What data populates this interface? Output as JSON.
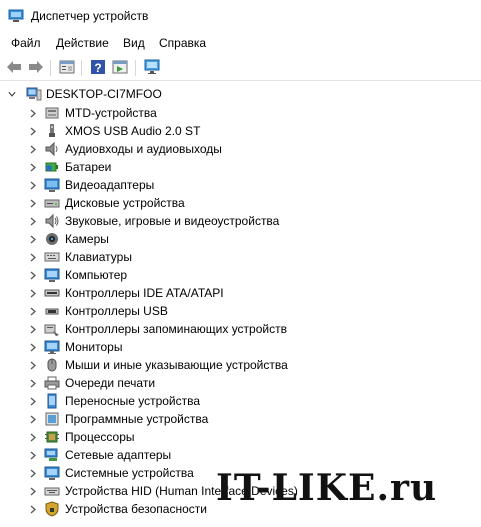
{
  "window": {
    "title": "Диспетчер устройств"
  },
  "menu": [
    {
      "label": "Файл"
    },
    {
      "label": "Действие"
    },
    {
      "label": "Вид"
    },
    {
      "label": "Справка"
    }
  ],
  "toolbar": {
    "buttons": [
      "back-arrow-icon",
      "forward-arrow-icon",
      "properties-icon",
      "help-icon",
      "run-icon",
      "monitor-scan-icon"
    ]
  },
  "tree": {
    "root": {
      "label": "DESKTOP-CI7MFOO",
      "icon": "computer-icon"
    },
    "items": [
      {
        "label": "MTD-устройства",
        "icon": "mtd-icon"
      },
      {
        "label": "XMOS USB Audio 2.0 ST",
        "icon": "usb-audio-icon"
      },
      {
        "label": "Аудиовходы и аудиовыходы",
        "icon": "speaker-icon"
      },
      {
        "label": "Батареи",
        "icon": "battery-icon"
      },
      {
        "label": "Видеоадаптеры",
        "icon": "display-adapter-icon"
      },
      {
        "label": "Дисковые устройства",
        "icon": "disk-drive-icon"
      },
      {
        "label": "Звуковые, игровые и видеоустройства",
        "icon": "sound-icon"
      },
      {
        "label": "Камеры",
        "icon": "camera-icon"
      },
      {
        "label": "Клавиатуры",
        "icon": "keyboard-icon"
      },
      {
        "label": "Компьютер",
        "icon": "computer-icon"
      },
      {
        "label": "Контроллеры IDE ATA/ATAPI",
        "icon": "ide-controller-icon"
      },
      {
        "label": "Контроллеры USB",
        "icon": "usb-controller-icon"
      },
      {
        "label": "Контроллеры запоминающих устройств",
        "icon": "storage-controller-icon"
      },
      {
        "label": "Мониторы",
        "icon": "monitor-icon"
      },
      {
        "label": "Мыши и иные указывающие устройства",
        "icon": "mouse-icon"
      },
      {
        "label": "Очереди печати",
        "icon": "printer-icon"
      },
      {
        "label": "Переносные устройства",
        "icon": "portable-device-icon"
      },
      {
        "label": "Программные устройства",
        "icon": "software-device-icon"
      },
      {
        "label": "Процессоры",
        "icon": "processor-icon"
      },
      {
        "label": "Сетевые адаптеры",
        "icon": "network-adapter-icon"
      },
      {
        "label": "Системные устройства",
        "icon": "system-device-icon"
      },
      {
        "label": "Устройства HID (Human Interface Devices)",
        "icon": "hid-icon"
      },
      {
        "label": "Устройства безопасности",
        "icon": "security-device-icon"
      }
    ]
  },
  "watermark": {
    "text": "IT-LIKE.ru"
  }
}
